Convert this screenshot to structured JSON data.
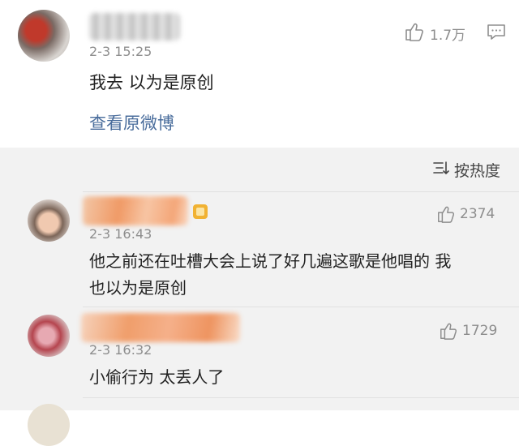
{
  "post": {
    "time": "2-3 15:25",
    "like_count": "1.7万",
    "text": "我去 以为是原创",
    "view_original": "查看原微博"
  },
  "sort": {
    "label": "按热度"
  },
  "comments": [
    {
      "time": "2-3 16:43",
      "like_count": "2374",
      "text_line1": "他之前还在吐槽大会上说了好几遍这歌是他唱的 我",
      "text_line2": "也以为是原创"
    },
    {
      "time": "2-3 16:32",
      "like_count": "1729",
      "text_line1": "小偷行为  太丢人了"
    }
  ],
  "icons": {
    "like": "thumbs-up-icon",
    "comment": "comment-icon",
    "sort": "sort-icon",
    "vip": "vip-badge-icon"
  },
  "colors": {
    "link": "#4a6d9c",
    "muted": "#8d8d8d",
    "background": "#f2f2f2"
  }
}
